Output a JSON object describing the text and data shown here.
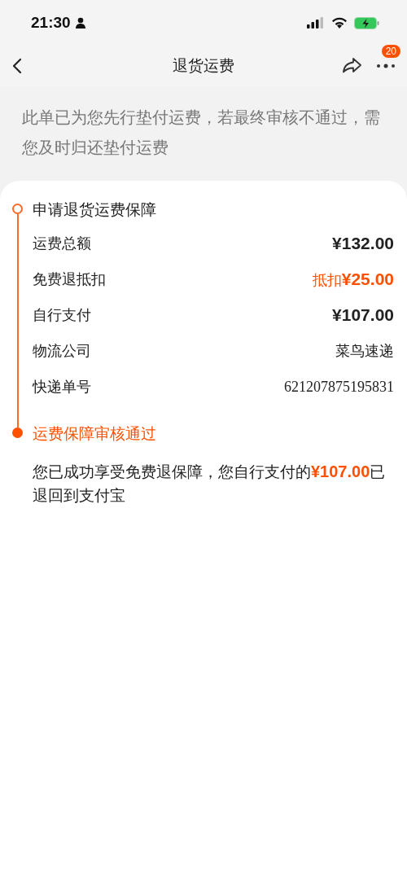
{
  "status_bar": {
    "time": "21:30"
  },
  "nav_bar": {
    "title": "退货运费",
    "badge": "20"
  },
  "notice": "此单已为您先行垫付运费，若最终审核不通过，需您及时归还垫付运费",
  "timeline": [
    {
      "title": "申请退货运费保障",
      "current": false,
      "rows": [
        {
          "label": "运费总额",
          "value": "¥132.00",
          "kind": "amount"
        },
        {
          "label": "免费退抵扣",
          "value": "抵扣**¥25.00**",
          "kind": "deduction"
        },
        {
          "label": "自行支付",
          "value": "¥107.00",
          "kind": "amount"
        },
        {
          "label": "物流公司",
          "value": "菜鸟速递",
          "kind": "text"
        },
        {
          "label": "快递单号",
          "value": "621207875195831",
          "kind": "number"
        }
      ]
    },
    {
      "title": "运费保障审核通过",
      "current": true,
      "description": "您已成功享受免费退保障，您自行支付的**¥107.00**已退回到支付宝"
    }
  ]
}
